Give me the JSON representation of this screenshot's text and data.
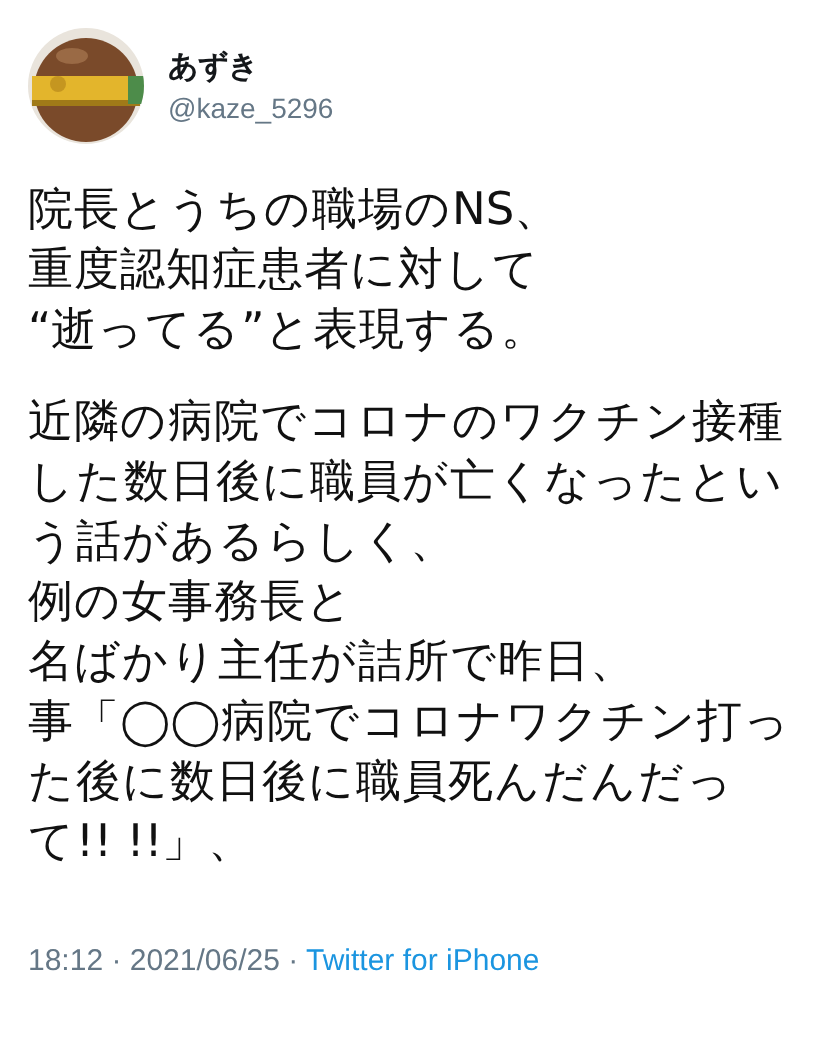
{
  "author": {
    "name": "あずき",
    "handle": "@kaze_5296"
  },
  "paragraphs": [
    {
      "lines": [
        "院長とうちの職場のNS、",
        "重度認知症患者に対して",
        "“逝ってる”と表現する。"
      ]
    },
    {
      "lines": [
        "近隣の病院でコロナのワクチン接種",
        "した数日後に職員が亡くなったとい",
        "う話があるらしく、",
        "例の女事務長と",
        "名ばかり主任が詰所で昨日、",
        "事「◯◯病院でコロナワクチン打っ",
        "た後に数日後に職員死んだんだっ",
        "て!! !!」、"
      ]
    }
  ],
  "footer": {
    "meta": "18:12 · 2021/06/25 · ",
    "source": "Twitter for iPhone"
  }
}
